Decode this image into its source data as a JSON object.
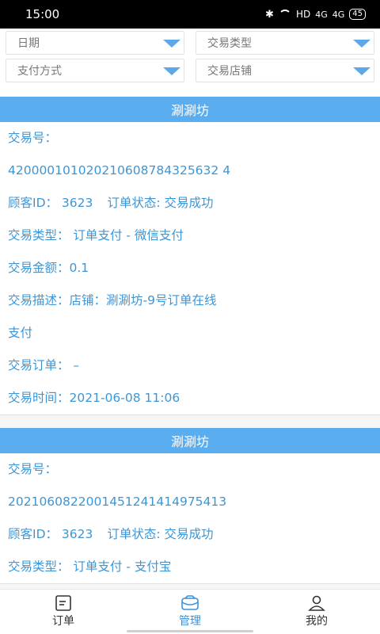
{
  "status_bar": {
    "time": "15:00",
    "network": "HD",
    "signal1": "4G",
    "signal2": "4G",
    "battery": "45"
  },
  "filters": {
    "date": "日期",
    "trade_type": "交易类型",
    "pay_method": "支付方式",
    "store": "交易店铺"
  },
  "cards": [
    {
      "store": "涮涮坊",
      "trade_no_label": "交易号：",
      "trade_no": "420000101020210608784325632 4",
      "customer_id": "顾客ID： 3623",
      "order_status": "订单状态: 交易成功",
      "trade_type": "交易类型： 订单支付 - 微信支付",
      "amount": "交易金额：0.1",
      "desc_line1": "交易描述：店铺：涮涮坊-9号订单在线",
      "desc_line2": "支付",
      "order": "交易订单： –",
      "time": "交易时间：2021-06-08 11:06"
    },
    {
      "store": "涮涮坊",
      "trade_no_label": "交易号：",
      "trade_no": "2021060822001451241414975413",
      "customer_id": "顾客ID： 3623",
      "order_status": "订单状态: 交易成功",
      "trade_type": "交易类型： 订单支付 - 支付宝"
    }
  ],
  "tabbar": {
    "orders": "订单",
    "manage": "管理",
    "mine": "我的"
  },
  "colors": {
    "accent": "#5aaef0",
    "text_blue": "#3c96d6",
    "active_tab": "#3a91d9"
  }
}
